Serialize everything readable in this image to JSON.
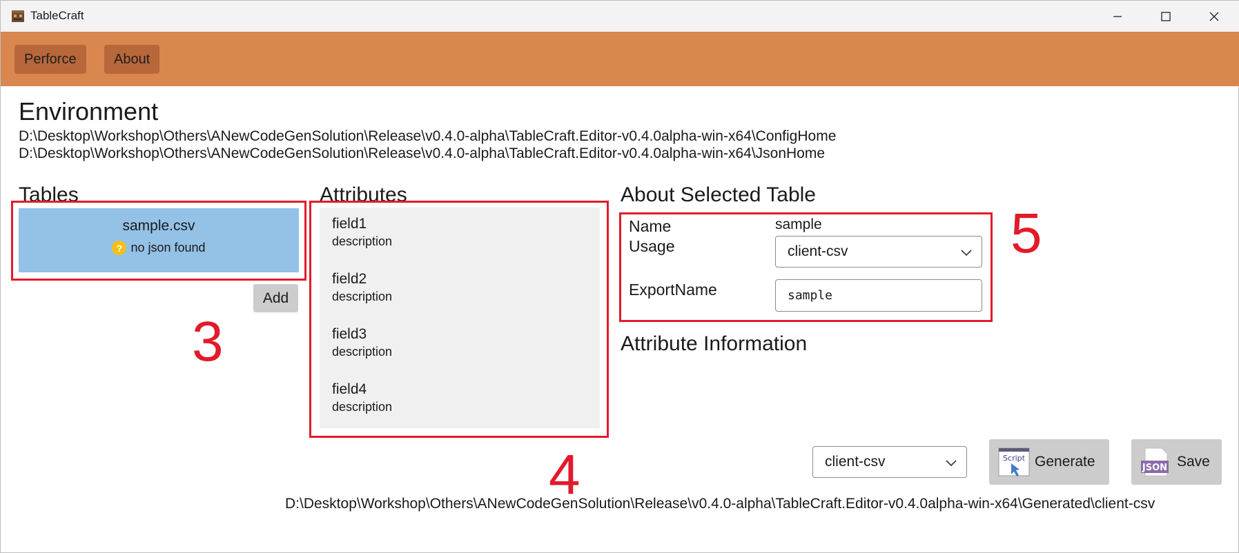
{
  "window": {
    "title": "TableCraft",
    "controls": [
      "minimize-icon",
      "maximize-icon",
      "close-icon"
    ]
  },
  "toolbar": {
    "perforce_label": "Perforce",
    "about_label": "About"
  },
  "environment": {
    "title": "Environment",
    "config_home": "D:\\Desktop\\Workshop\\Others\\ANewCodeGenSolution\\Release\\v0.4.0-alpha\\TableCraft.Editor-v0.4.0alpha-win-x64\\ConfigHome",
    "json_home": "D:\\Desktop\\Workshop\\Others\\ANewCodeGenSolution\\Release\\v0.4.0-alpha\\TableCraft.Editor-v0.4.0alpha-win-x64\\JsonHome"
  },
  "tables": {
    "title": "Tables",
    "items": [
      {
        "name": "sample.csv",
        "status": "no json found",
        "status_icon": "question-icon"
      }
    ],
    "add_label": "Add"
  },
  "attributes": {
    "title": "Attributes",
    "items": [
      {
        "name": "field1",
        "description": "description"
      },
      {
        "name": "field2",
        "description": "description"
      },
      {
        "name": "field3",
        "description": "description"
      },
      {
        "name": "field4",
        "description": "description"
      }
    ]
  },
  "about_selected": {
    "title": "About Selected Table",
    "name_label": "Name",
    "name_value": "sample",
    "usage_label": "Usage",
    "usage_value": "client-csv",
    "export_label": "ExportName",
    "export_value": "sample"
  },
  "attribute_information": {
    "title": "Attribute Information"
  },
  "generate": {
    "usage_value": "client-csv",
    "generate_label": "Generate",
    "generate_icon": "script-icon",
    "save_label": "Save",
    "save_icon": "json-icon",
    "output_path": "D:\\Desktop\\Workshop\\Others\\ANewCodeGenSolution\\Release\\v0.4.0-alpha\\TableCraft.Editor-v0.4.0alpha-win-x64\\Generated\\client-csv"
  },
  "annotations": [
    "3",
    "4",
    "5"
  ],
  "colors": {
    "toolbar": "#d9874f",
    "toolbar_button": "#b8673a",
    "selected_table": "#94c1e6",
    "annotation_red": "#e11b2a"
  }
}
